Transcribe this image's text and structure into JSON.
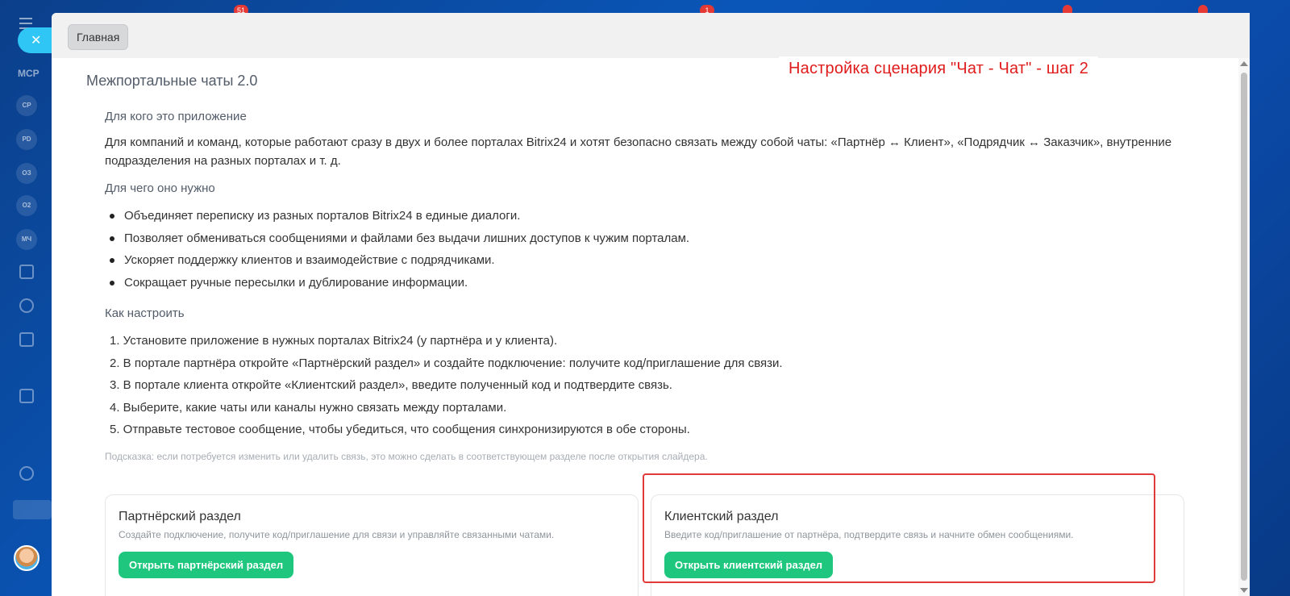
{
  "background": {
    "badges": [
      "51",
      "1"
    ],
    "sidebar_label": "МСР",
    "sidebar_items": [
      "СР",
      "PD",
      "ОЗ",
      "О2",
      "МЧ"
    ]
  },
  "slider": {
    "home_tab": "Главная",
    "app_title": "Межпортальные чаты 2.0",
    "annotation": "Настройка сценария \"Чат - Чат\" - шаг 2"
  },
  "content": {
    "who_title": "Для кого это приложение",
    "who_text": "Для компаний и команд, которые работают сразу в двух и более порталах Bitrix24 и хотят безопасно связать между собой чаты: «Партнёр ↔ Клиент», «Подрядчик ↔ Заказчик», внутренние подразделения на разных порталах и т. д.",
    "why_title": "Для чего оно нужно",
    "why_items": [
      "Объединяет переписку из разных порталов Bitrix24 в единые диалоги.",
      "Позволяет обмениваться сообщениями и файлами без выдачи лишних доступов к чужим порталам.",
      "Ускоряет поддержку клиентов и взаимодействие с подрядчиками.",
      "Сокращает ручные пересылки и дублирование информации."
    ],
    "how_title": "Как настроить",
    "how_steps": [
      "1. Установите приложение в нужных порталах Bitrix24 (у партнёра и у клиента).",
      "2. В портале партнёра откройте «Партнёрский раздел» и создайте подключение: получите код/приглашение для связи.",
      "3. В портале клиента откройте «Клиентский раздел», введите полученный код и подтвердите связь.",
      "4. Выберите, какие чаты или каналы нужно связать между порталами.",
      "5. Отправьте тестовое сообщение, чтобы убедиться, что сообщения синхронизируются в обе стороны."
    ],
    "hint": "Подсказка: если потребуется изменить или удалить связь, это можно сделать в соответствующем разделе после открытия слайдера."
  },
  "cards": {
    "partner": {
      "title": "Партнёрский раздел",
      "desc": "Создайте подключение, получите код/приглашение для связи и управляйте связанными чатами.",
      "button": "Открыть партнёрский раздел"
    },
    "client": {
      "title": "Клиентский раздел",
      "desc": "Введите код/приглашение от партнёра, подтвердите связь и начните обмен сообщениями.",
      "button": "Открыть клиентский раздел"
    }
  },
  "colors": {
    "accent_green": "#1fc77e",
    "annotation_red": "#e01b1b",
    "close_button": "#2fc6f6"
  }
}
